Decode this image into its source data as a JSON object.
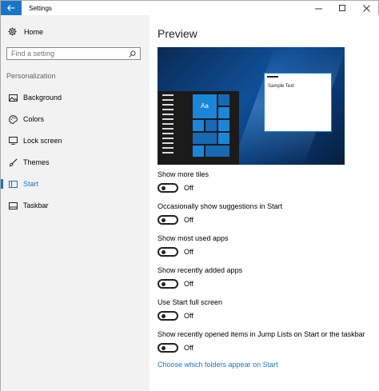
{
  "window": {
    "title": "Settings"
  },
  "sidebar": {
    "home_label": "Home",
    "search_placeholder": "Find a setting",
    "section_label": "Personalization",
    "items": [
      {
        "label": "Background",
        "icon": "picture-icon"
      },
      {
        "label": "Colors",
        "icon": "palette-icon"
      },
      {
        "label": "Lock screen",
        "icon": "lock-screen-icon"
      },
      {
        "label": "Themes",
        "icon": "brush-icon"
      },
      {
        "label": "Start",
        "icon": "start-menu-icon",
        "active": true
      },
      {
        "label": "Taskbar",
        "icon": "taskbar-icon"
      }
    ]
  },
  "main": {
    "title": "Preview",
    "preview": {
      "sample_text": "Sample Text",
      "tile_text": "Aa"
    },
    "settings": [
      {
        "label": "Show more tiles",
        "state": "Off"
      },
      {
        "label": "Occasionally show suggestions in Start",
        "state": "Off"
      },
      {
        "label": "Show most used apps",
        "state": "Off"
      },
      {
        "label": "Show recently added apps",
        "state": "Off"
      },
      {
        "label": "Use Start full screen",
        "state": "Off"
      },
      {
        "label": "Show recently opened items in Jump Lists on Start or the taskbar",
        "state": "Off"
      }
    ],
    "link_text": "Choose which folders appear on Start"
  },
  "colors": {
    "accent": "#1a75c9"
  }
}
